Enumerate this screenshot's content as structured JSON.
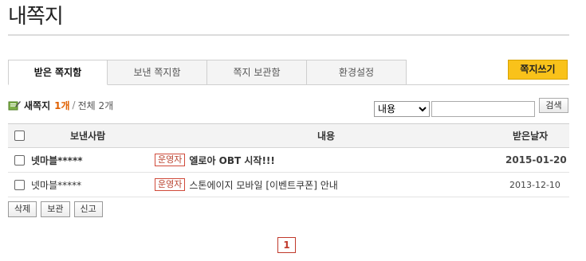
{
  "page": {
    "title": "내쪽지"
  },
  "tabs": [
    {
      "label": "받은 쪽지함",
      "active": true
    },
    {
      "label": "보낸 쪽지함",
      "active": false
    },
    {
      "label": "쪽지 보관함",
      "active": false
    },
    {
      "label": "환경설정",
      "active": false
    }
  ],
  "toolbar": {
    "write_label": "쪽지쓰기"
  },
  "summary": {
    "new_label": "새쪽지",
    "new_count": "1개",
    "separator": "/",
    "total": "전체 2개"
  },
  "search": {
    "select_value": "내용",
    "options": [
      "내용"
    ],
    "input_value": "",
    "button_label": "검색"
  },
  "table": {
    "headers": {
      "sender": "보낸사람",
      "content": "내용",
      "date": "받은날자"
    },
    "rows": [
      {
        "sender": "넷마블*****",
        "badge": "운영자",
        "subject": "엘로아 OBT 시작!!!",
        "date": "2015-01-20",
        "unread": true
      },
      {
        "sender": "넷마블*****",
        "badge": "운영자",
        "subject": "스톤에이지 모바일 [이벤트쿠폰] 안내",
        "date": "2013-12-10",
        "unread": false
      }
    ]
  },
  "actions": {
    "delete_label": "삭제",
    "archive_label": "보관",
    "report_label": "신고"
  },
  "pagination": {
    "current": "1"
  },
  "colors": {
    "accent": "#f9c21a",
    "new_count": "#e06000",
    "badge": "#b9432f",
    "pager": "#c0392b"
  }
}
